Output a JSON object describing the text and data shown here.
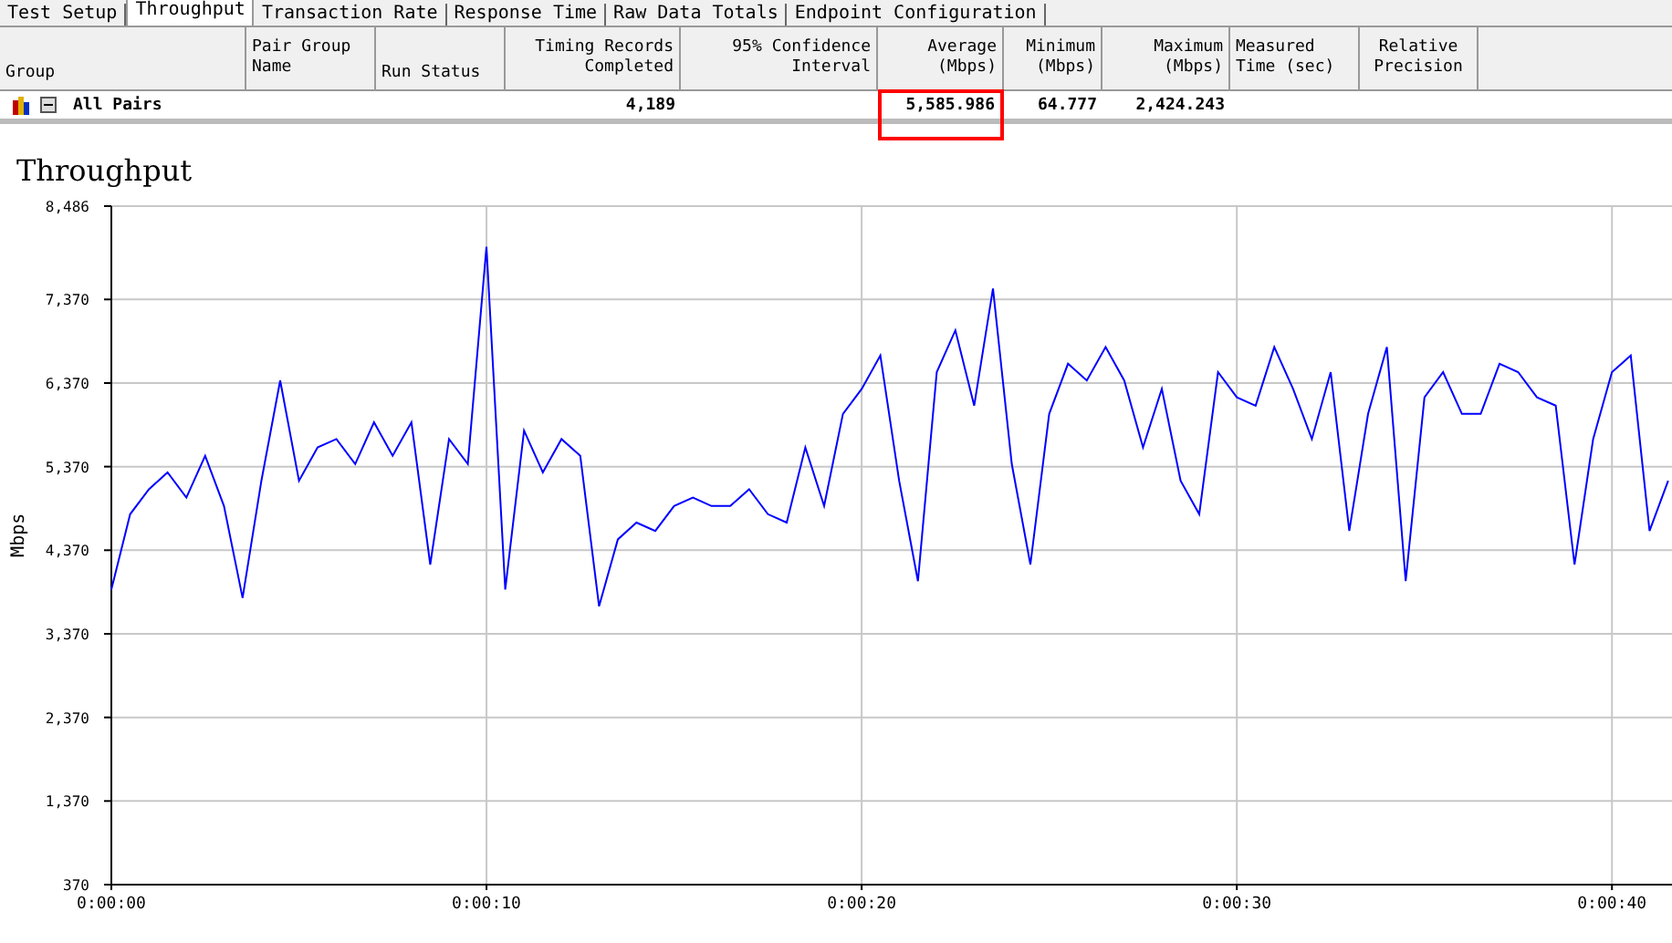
{
  "tabs": [
    {
      "label": "Test Setup",
      "selected": false
    },
    {
      "label": "Throughput",
      "selected": true
    },
    {
      "label": "Transaction Rate",
      "selected": false
    },
    {
      "label": "Response Time",
      "selected": false
    },
    {
      "label": "Raw Data Totals",
      "selected": false
    },
    {
      "label": "Endpoint Configuration",
      "selected": false
    }
  ],
  "table": {
    "columns": [
      "Group",
      "Pair Group Name",
      "Run Status",
      "Timing Records Completed",
      "95% Confidence Interval",
      "Average (Mbps)",
      "Minimum (Mbps)",
      "Maximum (Mbps)",
      "Measured Time (sec)",
      "Relative Precision"
    ],
    "rows": [
      {
        "expanded": true,
        "cells": [
          {
            "text": "All Pairs",
            "highlighted": false
          },
          {
            "text": "",
            "highlighted": false
          },
          {
            "text": "",
            "highlighted": false
          },
          {
            "text": "4,189",
            "highlighted": false
          },
          {
            "text": "",
            "highlighted": false
          },
          {
            "text": "5,585.986",
            "highlighted": true
          },
          {
            "text": "64.777",
            "highlighted": false
          },
          {
            "text": "2,424.243",
            "highlighted": false
          },
          {
            "text": "",
            "highlighted": false
          },
          {
            "text": "",
            "highlighted": false
          }
        ]
      }
    ]
  },
  "chart_title": "Throughput",
  "chart_data": {
    "type": "line",
    "grid": true,
    "ylabel": "Mbps",
    "xlim": [
      0,
      41.6
    ],
    "ylim": [
      370,
      8486
    ],
    "xticks": [
      {
        "value": 0,
        "label": "0:00:00"
      },
      {
        "value": 10,
        "label": "0:00:10"
      },
      {
        "value": 20,
        "label": "0:00:20"
      },
      {
        "value": 30,
        "label": "0:00:30"
      },
      {
        "value": 40,
        "label": "0:00:40"
      }
    ],
    "yticks": [
      {
        "value": 370,
        "label": "370"
      },
      {
        "value": 1370,
        "label": "1,370"
      },
      {
        "value": 2370,
        "label": "2,370"
      },
      {
        "value": 3370,
        "label": "3,370"
      },
      {
        "value": 4370,
        "label": "4,370"
      },
      {
        "value": 5370,
        "label": "5,370"
      },
      {
        "value": 6370,
        "label": "6,370"
      },
      {
        "value": 7370,
        "label": "7,370"
      },
      {
        "value": 8486,
        "label": "8,486"
      }
    ],
    "x": [
      0,
      0.5,
      1,
      1.5,
      2,
      2.5,
      3,
      3.5,
      4,
      4.5,
      5,
      5.5,
      6,
      6.5,
      7,
      7.5,
      8,
      8.5,
      9,
      9.5,
      10,
      10.5,
      11,
      11.5,
      12,
      12.5,
      13,
      13.5,
      14,
      14.5,
      15,
      15.5,
      16,
      16.5,
      17,
      17.5,
      18,
      18.5,
      19,
      19.5,
      20,
      20.5,
      21,
      21.5,
      22,
      22.5,
      23,
      23.5,
      24,
      24.5,
      25,
      25.5,
      26,
      26.5,
      27,
      27.5,
      28,
      28.5,
      29,
      29.5,
      30,
      30.5,
      31,
      31.5,
      32,
      32.5,
      33,
      33.5,
      34,
      34.5,
      35,
      35.5,
      36,
      36.5,
      37,
      37.5,
      38,
      38.5,
      39,
      39.5,
      40,
      40.5,
      41,
      41.5
    ],
    "series": [
      {
        "color": "#0000ff",
        "values": [
          3900,
          4800,
          5100,
          5300,
          5000,
          5500,
          4900,
          3800,
          5200,
          6400,
          5200,
          5600,
          5700,
          5400,
          5900,
          5500,
          5900,
          4200,
          5700,
          5400,
          8000,
          3900,
          5800,
          5300,
          5700,
          5500,
          3700,
          4500,
          4700,
          4600,
          4900,
          5000,
          4900,
          4900,
          5100,
          4800,
          4700,
          5600,
          4900,
          6000,
          6300,
          6700,
          5200,
          4000,
          6500,
          7000,
          6100,
          7500,
          5400,
          4200,
          6000,
          6600,
          6400,
          6800,
          6400,
          5600,
          6300,
          5200,
          4800,
          6500,
          6200,
          6100,
          6800,
          6300,
          5700,
          6500,
          4600,
          6000,
          6800,
          4000,
          6200,
          6500,
          6000,
          6000,
          6600,
          6500,
          6200,
          6100,
          4200,
          5700,
          6500,
          6700,
          4600,
          5200
        ]
      }
    ]
  }
}
